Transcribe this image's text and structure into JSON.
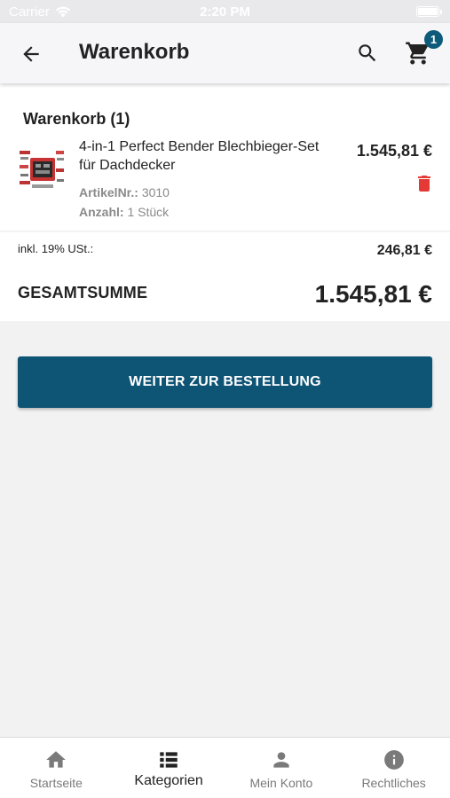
{
  "status_bar": {
    "carrier": "Carrier",
    "time": "2:20 PM"
  },
  "app_bar": {
    "title": "Warenkorb",
    "cart_count": "1"
  },
  "cart": {
    "heading": "Warenkorb (1)",
    "item": {
      "name": "4-in-1 Perfect Bender Blechbieger-Set für Dachdecker",
      "article_label": "ArtikelNr.:",
      "article_value": "3010",
      "qty_label": "Anzahl:",
      "qty_value": "1 Stück",
      "price": "1.545,81 €"
    }
  },
  "totals": {
    "tax_label": "inkl. 19% USt.:",
    "tax_value": "246,81 €",
    "sum_label": "GESAMTSUMME",
    "sum_value": "1.545,81 €"
  },
  "checkout": {
    "label": "WEITER ZUR BESTELLUNG"
  },
  "tabs": [
    {
      "label": "Startseite",
      "icon": "home-icon"
    },
    {
      "label": "Kategorien",
      "icon": "list-icon",
      "active": true
    },
    {
      "label": "Mein Konto",
      "icon": "person-icon"
    },
    {
      "label": "Rechtliches",
      "icon": "info-icon"
    }
  ],
  "colors": {
    "primary": "#0e5475",
    "badge": "#0d5a7a",
    "delete": "#e53935"
  }
}
